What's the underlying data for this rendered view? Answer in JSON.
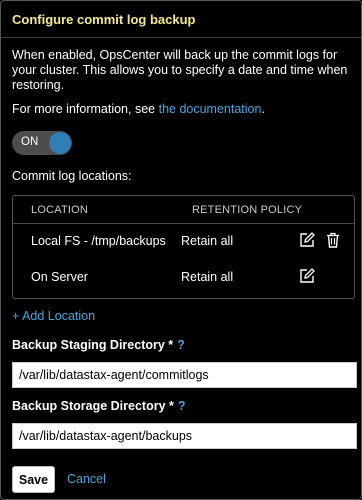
{
  "dialog": {
    "title": "Configure commit log backup",
    "intro": "When enabled, OpsCenter will back up the commit logs for your cluster. This allows you to specify a date and time when restoring.",
    "more_info_prefix": "For more information, see ",
    "more_info_link": "the documentation",
    "more_info_suffix": "."
  },
  "toggle": {
    "label": "ON",
    "state": true
  },
  "locations": {
    "heading": "Commit log locations:",
    "columns": [
      "LOCATION",
      "RETENTION POLICY"
    ],
    "rows": [
      {
        "location": "Local FS - /tmp/backups",
        "retention": "Retain all",
        "actions": [
          "edit-icon",
          "trash-icon"
        ]
      },
      {
        "location": "On Server",
        "retention": "Retain all",
        "actions": [
          "edit-icon"
        ]
      }
    ],
    "add_label": "+ Add Location"
  },
  "staging": {
    "label": "Backup Staging Directory *",
    "help": "?",
    "value": "/var/lib/datastax-agent/commitlogs"
  },
  "storage": {
    "label": "Backup Storage Directory *",
    "help": "?",
    "value": "/var/lib/datastax-agent/backups"
  },
  "buttons": {
    "save": "Save",
    "cancel": "Cancel"
  },
  "colors": {
    "title": "#f2e98d",
    "link": "#45a6dc",
    "toggle_knob": "#2f7fb5"
  }
}
